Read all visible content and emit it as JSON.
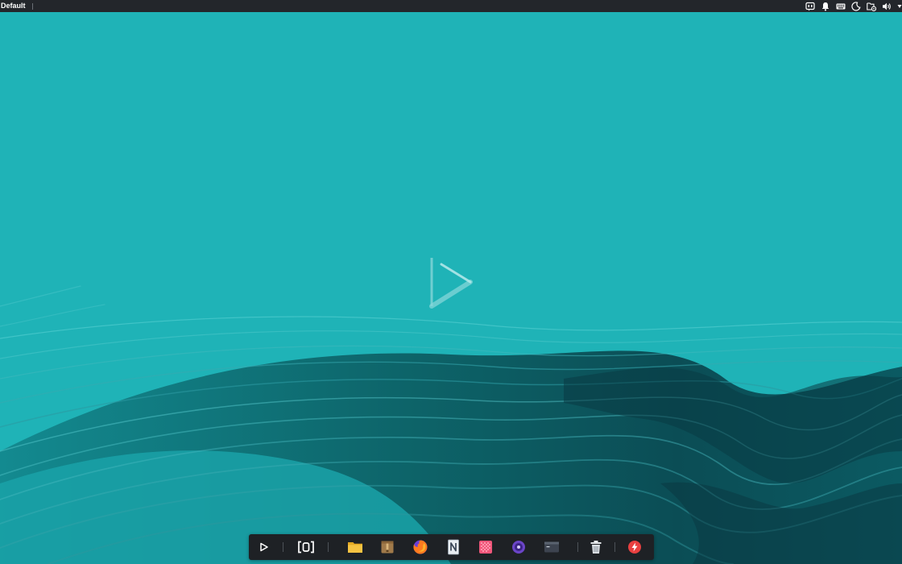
{
  "top_panel": {
    "workspace_label": "Default",
    "background": "#23262b",
    "tray_icons": [
      "tray-app-icon",
      "notification-bell-icon",
      "keyboard-icon",
      "night-light-icon",
      "network-folder-icon",
      "volume-icon",
      "power-icon"
    ]
  },
  "desktop": {
    "background_color": "#1fb3b7",
    "wave_colors": [
      "#1fb3b7",
      "#17878c",
      "#0e5a60",
      "#0a3c44"
    ],
    "center_logo": "play-triangle-logo"
  },
  "dock": {
    "background": "#1e2125",
    "items": [
      {
        "name": "app-launcher-icon"
      },
      {
        "name": "workspace-switcher-icon"
      },
      {
        "name": "file-manager-icon"
      },
      {
        "name": "archive-manager-icon"
      },
      {
        "name": "firefox-icon"
      },
      {
        "name": "notes-app-icon"
      },
      {
        "name": "color-grid-app-icon"
      },
      {
        "name": "media-player-icon"
      },
      {
        "name": "terminal-icon"
      },
      {
        "name": "trash-icon"
      },
      {
        "name": "power-app-icon"
      }
    ],
    "accent_colors": {
      "folder": "#f5c342",
      "firefox": "#ff7a1f",
      "grid_app": "#f0567a",
      "media": "#6b45c8",
      "power_app": "#e84040"
    }
  }
}
